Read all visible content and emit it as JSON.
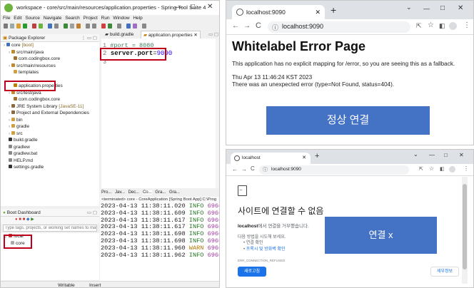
{
  "sts": {
    "title": "workspace - core/src/main/resources/application.properties - Spring Tool Suite 4",
    "menu": [
      "File",
      "Edit",
      "Source",
      "Navigate",
      "Search",
      "Project",
      "Run",
      "Window",
      "Help"
    ],
    "package_explorer": {
      "title": "Package Explorer",
      "items": [
        {
          "label": "core",
          "suffix": "[boot]",
          "indent": 0,
          "icon": "project-icon"
        },
        {
          "label": "src/main/java",
          "indent": 1,
          "icon": "source-folder-icon"
        },
        {
          "label": "com.codingbox.core",
          "indent": 2,
          "icon": "package-icon"
        },
        {
          "label": "src/main/resources",
          "indent": 1,
          "icon": "source-folder-icon"
        },
        {
          "label": "templates",
          "indent": 2,
          "icon": "folder-icon"
        },
        {
          "label": "",
          "indent": 2,
          "icon": ""
        },
        {
          "label": "application.properties",
          "indent": 2,
          "icon": "properties-file-icon"
        },
        {
          "label": "src/test/java",
          "indent": 1,
          "icon": "source-folder-icon"
        },
        {
          "label": "com.codingbox.core",
          "indent": 2,
          "icon": "package-icon"
        },
        {
          "label": "JRE System Library",
          "suffix": "[JavaSE-11]",
          "indent": 1,
          "icon": "library-icon"
        },
        {
          "label": "Project and External Dependencies",
          "indent": 1,
          "icon": "library-icon"
        },
        {
          "label": "bin",
          "indent": 1,
          "icon": "folder-icon"
        },
        {
          "label": "gradle",
          "indent": 1,
          "icon": "folder-icon"
        },
        {
          "label": "src",
          "indent": 1,
          "icon": "folder-icon"
        },
        {
          "label": "build.gradle",
          "indent": 1,
          "icon": "gradle-file-icon"
        },
        {
          "label": "gradlew",
          "indent": 1,
          "icon": "file-icon"
        },
        {
          "label": "gradlew.bat",
          "indent": 1,
          "icon": "file-icon"
        },
        {
          "label": "HELP.md",
          "indent": 1,
          "icon": "file-icon"
        },
        {
          "label": "settings.gradle",
          "indent": 1,
          "icon": "gradle-file-icon"
        }
      ]
    },
    "editor": {
      "tabs": [
        "build.gradle",
        "application.properties"
      ],
      "lines": [
        {
          "num": "1",
          "text": "#port = 8080"
        },
        {
          "num": "2",
          "key": "server.port",
          "eq": "=",
          "val": "9090"
        },
        {
          "num": "3",
          "text": ""
        }
      ]
    },
    "console": {
      "tabs": [
        "Pro...",
        "Jav...",
        "Dec...",
        "Co...",
        "Gra...",
        "Gra..."
      ],
      "header": "<terminated> core - CoreApplication [Spring Boot App] C:\\Prog",
      "rows": [
        {
          "ts": "2023-04-13 11:38:11.020",
          "level": "INFO",
          "pid": "6960",
          "tail": "---"
        },
        {
          "ts": "2023-04-13 11:38:11.609",
          "level": "INFO",
          "pid": "6960",
          "tail": "---"
        },
        {
          "ts": "2023-04-13 11:38:11.617",
          "level": "INFO",
          "pid": "6960",
          "tail": "---"
        },
        {
          "ts": "2023-04-13 11:38:11.617",
          "level": "INFO",
          "pid": "6960",
          "tail": "---"
        },
        {
          "ts": "2023-04-13 11:38:11.698",
          "level": "INFO",
          "pid": "6960",
          "tail": "---"
        },
        {
          "ts": "2023-04-13 11:38:11.698",
          "level": "INFO",
          "pid": "6960",
          "tail": "---"
        },
        {
          "ts": "2023-04-13 11:38:11.960",
          "level": "WARN",
          "pid": "6960",
          "tail": "---"
        },
        {
          "ts": "2023-04-13 11:38:11.962",
          "level": "INFO",
          "pid": "6960",
          "tail": "---"
        }
      ]
    },
    "boot_dashboard": {
      "title": "Boot Dashboard",
      "filter_placeholder": "Type tags, projects, or working set names to match",
      "group": "local",
      "app": "core"
    },
    "status": {
      "writable": "Writable",
      "insert": "Insert"
    }
  },
  "chrome_top": {
    "tab_title": "localhost:9090",
    "url": "localhost:9090",
    "heading": "Whitelabel Error Page",
    "message": "This application has no explicit mapping for /error, so you are seeing this as a fallback.",
    "timestamp": "Thu Apr 13 11:46:24 KST 2023",
    "error": "There was an unexpected error (type=Not Found, status=404).",
    "overlay": "정상 연결"
  },
  "chrome_bottom": {
    "tab_title": "localhost",
    "url": "localhost:9090",
    "heading": "사이트에 연결할 수 없음",
    "host": "localhost",
    "refused": "에서 연결을 거부했습니다.",
    "try_intro": "다음 방법을 시도해 보세요.",
    "tips": [
      "연결 확인",
      "프록시 및 방화벽 확인"
    ],
    "error_code": "ERR_CONNECTION_REFUSED",
    "reload": "새로고침",
    "details": "세부정보",
    "overlay": "연결 x"
  },
  "colors": {
    "highlight_red": "#c0001a",
    "overlay_blue": "#4472c4",
    "link_blue": "#1a73e8"
  }
}
